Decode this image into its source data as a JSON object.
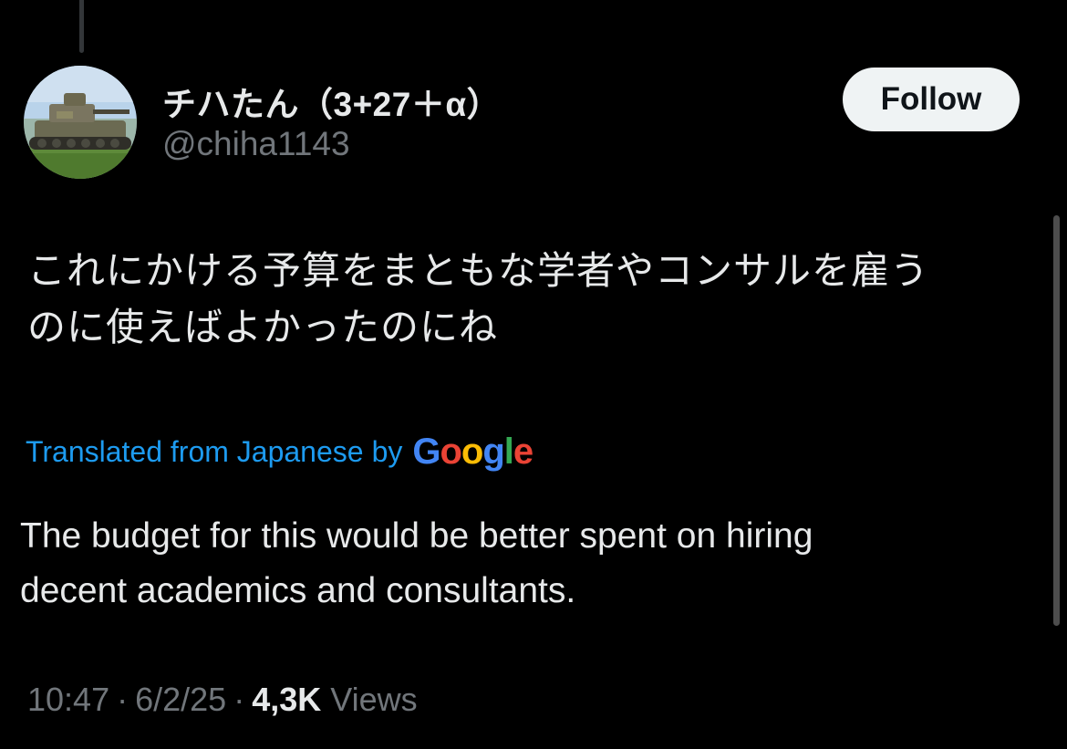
{
  "author": {
    "display_name": "チハたん（3+27＋α）",
    "handle": "@chiha1143",
    "avatar_icon": "tank-photo-avatar"
  },
  "follow_label": "Follow",
  "tweet": {
    "original_line1": "これにかける予算をまともな学者やコンサルを雇う",
    "original_line2": "のに使えばよかったのにね",
    "translated_from": "Translated from Japanese",
    "translated_by": "by",
    "translator_brand": {
      "letters": [
        "G",
        "o",
        "o",
        "g",
        "l",
        "e"
      ],
      "colors": [
        "#4285F4",
        "#EA4335",
        "#FBBC05",
        "#4285F4",
        "#34A853",
        "#EA4335"
      ]
    },
    "translation_line1": "The budget for this would be better spent on hiring",
    "translation_line2": "decent academics and consultants."
  },
  "meta": {
    "time": "10:47",
    "date": "6/2/25",
    "views_count": "4,3K",
    "views_label": "Views",
    "separator": "·"
  },
  "colors": {
    "background": "#000000",
    "primary_text": "#e7e9ea",
    "secondary_text": "#71767b",
    "link": "#1d9bf0",
    "follow_bg": "#eff3f4"
  }
}
